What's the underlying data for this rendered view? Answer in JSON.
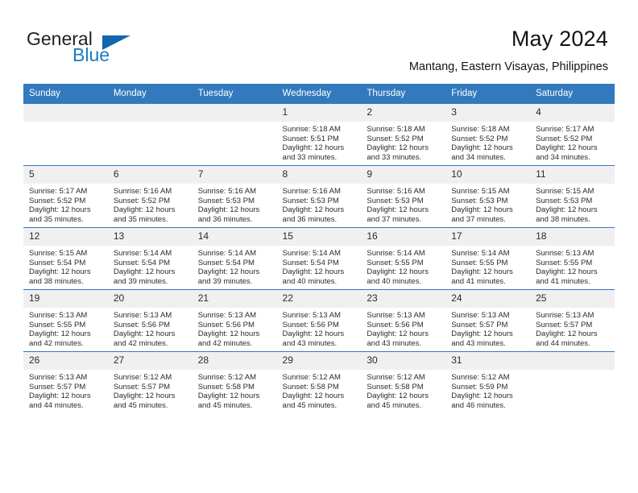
{
  "brand": {
    "name_part1": "General",
    "name_part2": "Blue",
    "accent_color": "#1c7ac0",
    "logo_triangle_color": "#1266ab"
  },
  "header": {
    "month_title": "May 2024",
    "location": "Mantang, Eastern Visayas, Philippines"
  },
  "calendar": {
    "header_bg": "#3279bd",
    "daynum_bg": "#f0f0f0",
    "weekday_headers": [
      "Sunday",
      "Monday",
      "Tuesday",
      "Wednesday",
      "Thursday",
      "Friday",
      "Saturday"
    ],
    "weeks": [
      [
        {
          "day": "",
          "sunrise": "",
          "sunset": "",
          "daylight_line1": "",
          "daylight_line2": "",
          "empty": true
        },
        {
          "day": "",
          "sunrise": "",
          "sunset": "",
          "daylight_line1": "",
          "daylight_line2": "",
          "empty": true
        },
        {
          "day": "",
          "sunrise": "",
          "sunset": "",
          "daylight_line1": "",
          "daylight_line2": "",
          "empty": true
        },
        {
          "day": "1",
          "sunrise": "Sunrise: 5:18 AM",
          "sunset": "Sunset: 5:51 PM",
          "daylight_line1": "Daylight: 12 hours",
          "daylight_line2": "and 33 minutes.",
          "empty": false
        },
        {
          "day": "2",
          "sunrise": "Sunrise: 5:18 AM",
          "sunset": "Sunset: 5:52 PM",
          "daylight_line1": "Daylight: 12 hours",
          "daylight_line2": "and 33 minutes.",
          "empty": false
        },
        {
          "day": "3",
          "sunrise": "Sunrise: 5:18 AM",
          "sunset": "Sunset: 5:52 PM",
          "daylight_line1": "Daylight: 12 hours",
          "daylight_line2": "and 34 minutes.",
          "empty": false
        },
        {
          "day": "4",
          "sunrise": "Sunrise: 5:17 AM",
          "sunset": "Sunset: 5:52 PM",
          "daylight_line1": "Daylight: 12 hours",
          "daylight_line2": "and 34 minutes.",
          "empty": false
        }
      ],
      [
        {
          "day": "5",
          "sunrise": "Sunrise: 5:17 AM",
          "sunset": "Sunset: 5:52 PM",
          "daylight_line1": "Daylight: 12 hours",
          "daylight_line2": "and 35 minutes.",
          "empty": false
        },
        {
          "day": "6",
          "sunrise": "Sunrise: 5:16 AM",
          "sunset": "Sunset: 5:52 PM",
          "daylight_line1": "Daylight: 12 hours",
          "daylight_line2": "and 35 minutes.",
          "empty": false
        },
        {
          "day": "7",
          "sunrise": "Sunrise: 5:16 AM",
          "sunset": "Sunset: 5:53 PM",
          "daylight_line1": "Daylight: 12 hours",
          "daylight_line2": "and 36 minutes.",
          "empty": false
        },
        {
          "day": "8",
          "sunrise": "Sunrise: 5:16 AM",
          "sunset": "Sunset: 5:53 PM",
          "daylight_line1": "Daylight: 12 hours",
          "daylight_line2": "and 36 minutes.",
          "empty": false
        },
        {
          "day": "9",
          "sunrise": "Sunrise: 5:16 AM",
          "sunset": "Sunset: 5:53 PM",
          "daylight_line1": "Daylight: 12 hours",
          "daylight_line2": "and 37 minutes.",
          "empty": false
        },
        {
          "day": "10",
          "sunrise": "Sunrise: 5:15 AM",
          "sunset": "Sunset: 5:53 PM",
          "daylight_line1": "Daylight: 12 hours",
          "daylight_line2": "and 37 minutes.",
          "empty": false
        },
        {
          "day": "11",
          "sunrise": "Sunrise: 5:15 AM",
          "sunset": "Sunset: 5:53 PM",
          "daylight_line1": "Daylight: 12 hours",
          "daylight_line2": "and 38 minutes.",
          "empty": false
        }
      ],
      [
        {
          "day": "12",
          "sunrise": "Sunrise: 5:15 AM",
          "sunset": "Sunset: 5:54 PM",
          "daylight_line1": "Daylight: 12 hours",
          "daylight_line2": "and 38 minutes.",
          "empty": false
        },
        {
          "day": "13",
          "sunrise": "Sunrise: 5:14 AM",
          "sunset": "Sunset: 5:54 PM",
          "daylight_line1": "Daylight: 12 hours",
          "daylight_line2": "and 39 minutes.",
          "empty": false
        },
        {
          "day": "14",
          "sunrise": "Sunrise: 5:14 AM",
          "sunset": "Sunset: 5:54 PM",
          "daylight_line1": "Daylight: 12 hours",
          "daylight_line2": "and 39 minutes.",
          "empty": false
        },
        {
          "day": "15",
          "sunrise": "Sunrise: 5:14 AM",
          "sunset": "Sunset: 5:54 PM",
          "daylight_line1": "Daylight: 12 hours",
          "daylight_line2": "and 40 minutes.",
          "empty": false
        },
        {
          "day": "16",
          "sunrise": "Sunrise: 5:14 AM",
          "sunset": "Sunset: 5:55 PM",
          "daylight_line1": "Daylight: 12 hours",
          "daylight_line2": "and 40 minutes.",
          "empty": false
        },
        {
          "day": "17",
          "sunrise": "Sunrise: 5:14 AM",
          "sunset": "Sunset: 5:55 PM",
          "daylight_line1": "Daylight: 12 hours",
          "daylight_line2": "and 41 minutes.",
          "empty": false
        },
        {
          "day": "18",
          "sunrise": "Sunrise: 5:13 AM",
          "sunset": "Sunset: 5:55 PM",
          "daylight_line1": "Daylight: 12 hours",
          "daylight_line2": "and 41 minutes.",
          "empty": false
        }
      ],
      [
        {
          "day": "19",
          "sunrise": "Sunrise: 5:13 AM",
          "sunset": "Sunset: 5:55 PM",
          "daylight_line1": "Daylight: 12 hours",
          "daylight_line2": "and 42 minutes.",
          "empty": false
        },
        {
          "day": "20",
          "sunrise": "Sunrise: 5:13 AM",
          "sunset": "Sunset: 5:56 PM",
          "daylight_line1": "Daylight: 12 hours",
          "daylight_line2": "and 42 minutes.",
          "empty": false
        },
        {
          "day": "21",
          "sunrise": "Sunrise: 5:13 AM",
          "sunset": "Sunset: 5:56 PM",
          "daylight_line1": "Daylight: 12 hours",
          "daylight_line2": "and 42 minutes.",
          "empty": false
        },
        {
          "day": "22",
          "sunrise": "Sunrise: 5:13 AM",
          "sunset": "Sunset: 5:56 PM",
          "daylight_line1": "Daylight: 12 hours",
          "daylight_line2": "and 43 minutes.",
          "empty": false
        },
        {
          "day": "23",
          "sunrise": "Sunrise: 5:13 AM",
          "sunset": "Sunset: 5:56 PM",
          "daylight_line1": "Daylight: 12 hours",
          "daylight_line2": "and 43 minutes.",
          "empty": false
        },
        {
          "day": "24",
          "sunrise": "Sunrise: 5:13 AM",
          "sunset": "Sunset: 5:57 PM",
          "daylight_line1": "Daylight: 12 hours",
          "daylight_line2": "and 43 minutes.",
          "empty": false
        },
        {
          "day": "25",
          "sunrise": "Sunrise: 5:13 AM",
          "sunset": "Sunset: 5:57 PM",
          "daylight_line1": "Daylight: 12 hours",
          "daylight_line2": "and 44 minutes.",
          "empty": false
        }
      ],
      [
        {
          "day": "26",
          "sunrise": "Sunrise: 5:13 AM",
          "sunset": "Sunset: 5:57 PM",
          "daylight_line1": "Daylight: 12 hours",
          "daylight_line2": "and 44 minutes.",
          "empty": false
        },
        {
          "day": "27",
          "sunrise": "Sunrise: 5:12 AM",
          "sunset": "Sunset: 5:57 PM",
          "daylight_line1": "Daylight: 12 hours",
          "daylight_line2": "and 45 minutes.",
          "empty": false
        },
        {
          "day": "28",
          "sunrise": "Sunrise: 5:12 AM",
          "sunset": "Sunset: 5:58 PM",
          "daylight_line1": "Daylight: 12 hours",
          "daylight_line2": "and 45 minutes.",
          "empty": false
        },
        {
          "day": "29",
          "sunrise": "Sunrise: 5:12 AM",
          "sunset": "Sunset: 5:58 PM",
          "daylight_line1": "Daylight: 12 hours",
          "daylight_line2": "and 45 minutes.",
          "empty": false
        },
        {
          "day": "30",
          "sunrise": "Sunrise: 5:12 AM",
          "sunset": "Sunset: 5:58 PM",
          "daylight_line1": "Daylight: 12 hours",
          "daylight_line2": "and 45 minutes.",
          "empty": false
        },
        {
          "day": "31",
          "sunrise": "Sunrise: 5:12 AM",
          "sunset": "Sunset: 5:59 PM",
          "daylight_line1": "Daylight: 12 hours",
          "daylight_line2": "and 46 minutes.",
          "empty": false
        },
        {
          "day": "",
          "sunrise": "",
          "sunset": "",
          "daylight_line1": "",
          "daylight_line2": "",
          "empty": true
        }
      ]
    ]
  }
}
